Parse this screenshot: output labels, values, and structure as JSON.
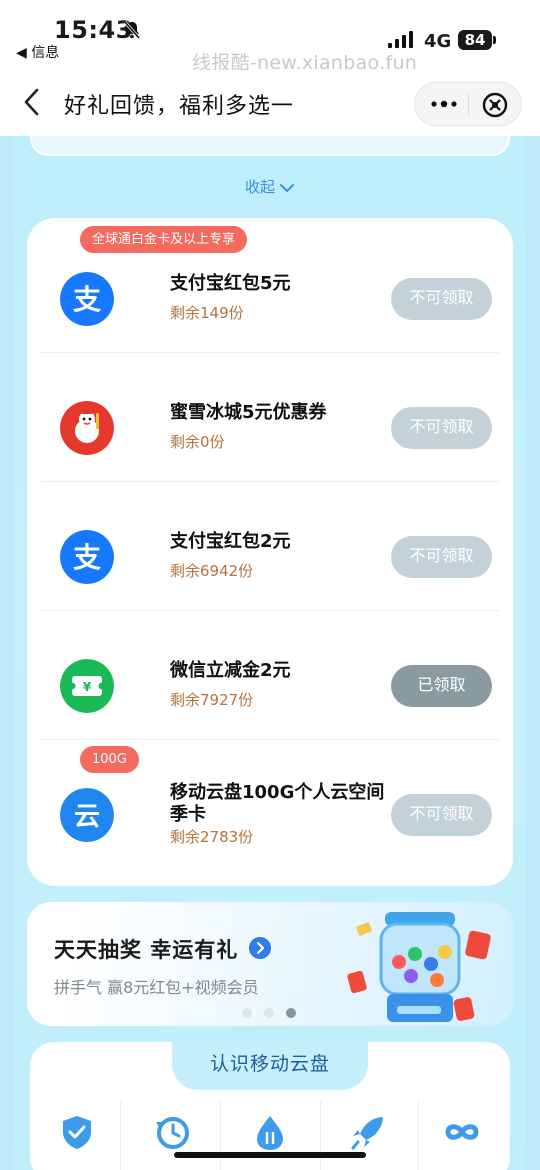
{
  "status_bar": {
    "time": "15:43",
    "back_app": "◀ 信息",
    "network": "4G",
    "battery": "84",
    "watermark": "线报酷-new.xianbao.fun"
  },
  "navbar": {
    "title": "好礼回馈，福利多选一",
    "more_icon": "more-dots-icon",
    "close_icon": "close-circle-icon"
  },
  "collapse_label": "收起",
  "rewards": [
    {
      "badge": "全球通白金卡及以上专享",
      "icon": "alipay-icon",
      "title": "支付宝红包5元",
      "remain": "剩余149份",
      "button": "不可领取",
      "state": "disabled"
    },
    {
      "badge": "",
      "icon": "mixue-icon",
      "title": "蜜雪冰城5元优惠券",
      "remain": "剩余0份",
      "button": "不可领取",
      "state": "disabled"
    },
    {
      "badge": "",
      "icon": "alipay-icon",
      "title": "支付宝红包2元",
      "remain": "剩余6942份",
      "button": "不可领取",
      "state": "disabled"
    },
    {
      "badge": "",
      "icon": "wechat-voucher-icon",
      "title": "微信立减金2元",
      "remain": "剩余7927份",
      "button": "已领取",
      "state": "claimed"
    },
    {
      "badge": "100G",
      "icon": "cloud-drive-icon",
      "title": "移动云盘100G个人云空间季卡",
      "remain": "剩余2783份",
      "button": "不可领取",
      "state": "disabled"
    }
  ],
  "lottery": {
    "title": "天天抽奖 幸运有礼",
    "subtitle": "拼手气 赢8元红包+视频会员",
    "pages": 3,
    "active_page": 3
  },
  "know_card": {
    "title": "认识移动云盘",
    "feature_icons": [
      "shield-check-icon",
      "clock-restore-icon",
      "transfer-drop-icon",
      "rocket-icon",
      "infinity-icon"
    ]
  },
  "colors": {
    "accent_blue": "#3a8fe0",
    "badge_red": "#f36b5f",
    "remain_brown": "#b5733c",
    "button_disabled": "#c3d2d8",
    "button_claimed": "#8a9aa1"
  }
}
